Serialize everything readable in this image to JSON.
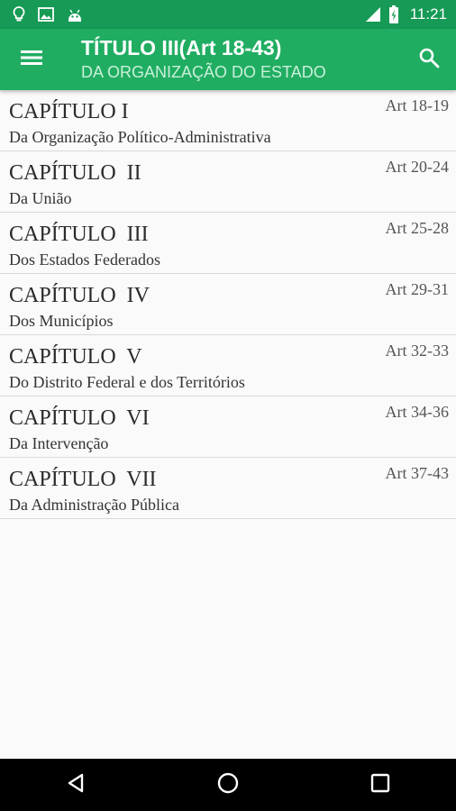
{
  "status_bar": {
    "time": "11:21",
    "left_icons": [
      "lightbulb-icon",
      "image-icon",
      "android-icon"
    ],
    "right_icons": [
      "signal-icon",
      "battery-charging-icon"
    ]
  },
  "app_bar": {
    "title": "TÍTULO III(Art 18-43)",
    "subtitle": "DA ORGANIZAÇÃO DO ESTADO",
    "menu_icon": "hamburger-menu-icon",
    "search_icon": "search-icon",
    "color": "#20ad62"
  },
  "chapters": [
    {
      "title": "CAPÍTULO I",
      "range": "Art 18-19",
      "description": "Da Organização Político-Administrativa"
    },
    {
      "title": "CAPÍTULO  II",
      "range": "Art 20-24",
      "description": "Da União"
    },
    {
      "title": "CAPÍTULO  III",
      "range": "Art 25-28",
      "description": "Dos Estados Federados"
    },
    {
      "title": "CAPÍTULO  IV",
      "range": "Art 29-31",
      "description": "Dos Municípios"
    },
    {
      "title": "CAPÍTULO  V",
      "range": "Art 32-33",
      "description": "Do Distrito Federal e dos Territórios"
    },
    {
      "title": "CAPÍTULO  VI",
      "range": "Art 34-36",
      "description": "Da Intervenção"
    },
    {
      "title": "CAPÍTULO  VII",
      "range": "Art 37-43",
      "description": "Da Administração Pública"
    }
  ],
  "nav_bar": {
    "icons": [
      "back-icon",
      "home-icon",
      "recents-icon"
    ]
  }
}
